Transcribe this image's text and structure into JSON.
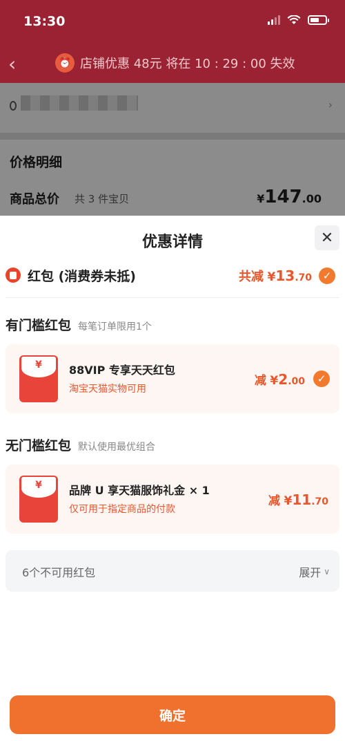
{
  "status_bar": {
    "time": "13:30"
  },
  "nav": {
    "promo_text": "店铺优惠 48元 将在 10 : 29 : 00 失效"
  },
  "price_detail": {
    "title": "价格明细",
    "total_label": "商品总价",
    "total_count": "共 3 件宝贝",
    "currency": "¥",
    "total_int": "147",
    "total_dec": ".00"
  },
  "sheet": {
    "title": "优惠详情",
    "summary": {
      "label": "红包 (消费券未抵)",
      "prefix": "共减",
      "currency": "¥",
      "amount_int": "13",
      "amount_dec": ".70"
    },
    "threshold_section": {
      "title": "有门槛红包",
      "subtitle": "每笔订单限用1个",
      "coupon": {
        "icon_glyph": "¥",
        "name": "88VIP 专享天天红包",
        "desc": "淘宝天猫实物可用",
        "prefix": "减",
        "currency": "¥",
        "amount_int": "2",
        "amount_dec": ".00"
      }
    },
    "no_threshold_section": {
      "title": "无门槛红包",
      "subtitle": "默认使用最优组合",
      "coupon": {
        "icon_glyph": "¥",
        "name": "品牌 U 享天猫服饰礼金 × 1",
        "desc": "仅可用于指定商品的付款",
        "prefix": "减",
        "currency": "¥",
        "amount_int": "11",
        "amount_dec": ".70"
      }
    },
    "unavailable": {
      "label": "6个不可用红包",
      "expand": "展开"
    },
    "confirm": "确定"
  },
  "colors": {
    "accent": "#f0712d",
    "price_red": "#e8572c",
    "envelope": "#e8443a",
    "header_bg": "#9b2232"
  },
  "icons": {
    "back": "chevron-left-icon",
    "alarm": "alarm-clock-icon",
    "close": "close-icon",
    "check": "check-circle-icon",
    "envelope": "red-envelope-icon"
  }
}
